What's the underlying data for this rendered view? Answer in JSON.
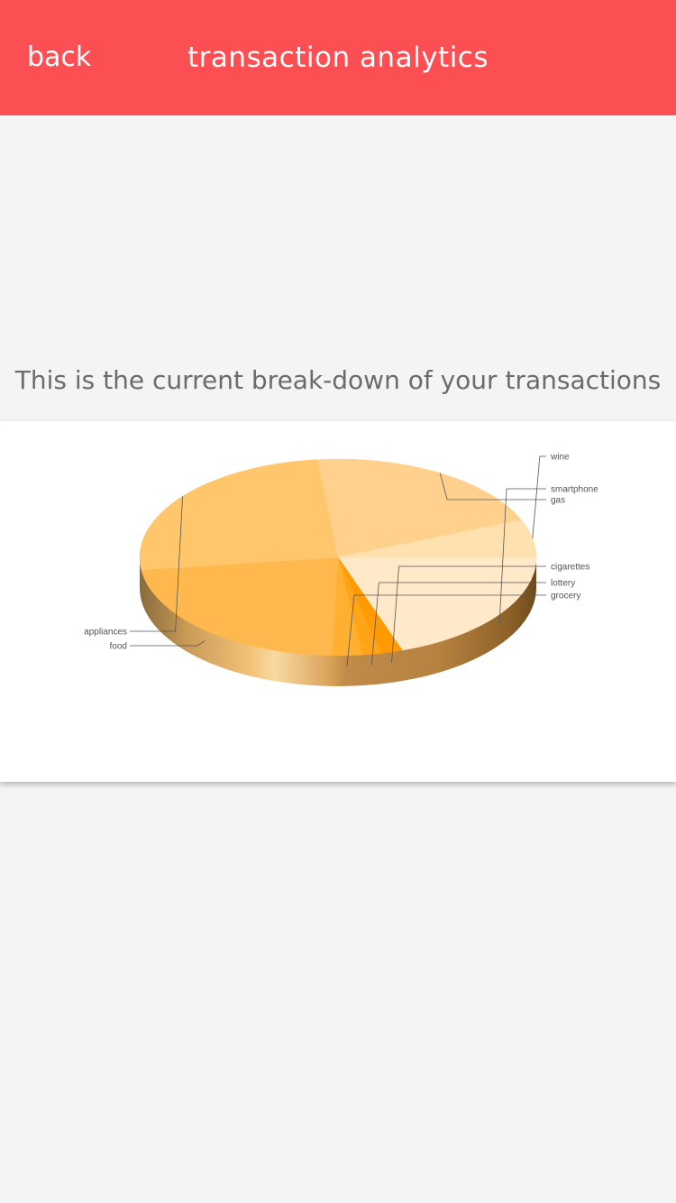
{
  "header": {
    "back_label": "back",
    "title": "transaction analytics"
  },
  "intro_text": "This is the current break-down of your transactions",
  "chart_data": {
    "type": "pie",
    "title": "",
    "three_d": true,
    "categories": [
      "smartphone",
      "cigarettes",
      "lottery",
      "grocery",
      "food",
      "appliances",
      "gas",
      "wine"
    ],
    "values": [
      19.8,
      1.8,
      1.5,
      2.5,
      22.5,
      25.5,
      20.5,
      6.2
    ],
    "colors": [
      "#ffe9c8",
      "#ff9a00",
      "#ffa417",
      "#ffb030",
      "#ffb84e",
      "#ffc66c",
      "#ffd18c",
      "#ffe1b0"
    ],
    "labels_position": "outside",
    "legend": "none"
  }
}
